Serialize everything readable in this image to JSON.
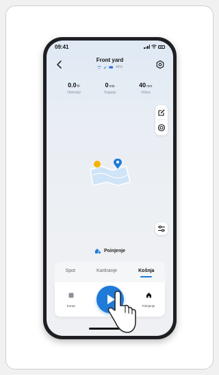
{
  "status_bar": {
    "time": "09:41"
  },
  "header": {
    "title": "Front yard",
    "battery_percent": "46%"
  },
  "stats": [
    {
      "value": "0.0",
      "unit": "ft²",
      "label": "Območje"
    },
    {
      "value": "0",
      "unit": "min",
      "label": "Trajanje"
    },
    {
      "value": "40",
      "unit": "mm",
      "label": "Višina"
    }
  ],
  "zone": {
    "label": "Poinjenje"
  },
  "modes": [
    {
      "label": "Spot",
      "active": false
    },
    {
      "label": "Kartiranje",
      "active": false
    },
    {
      "label": "Košnja",
      "active": true
    }
  ],
  "controls": {
    "stop_label": "Konec",
    "dock_label": "Polnjenje"
  },
  "colors": {
    "accent": "#1f7ad8",
    "background": "#eef0f3",
    "frame": "#1e1f22"
  },
  "icons": {
    "back": "chevron-left-icon",
    "settings": "hexagon-settings-icon",
    "edit": "edit-icon",
    "target": "target-icon",
    "adjust": "sliders-icon",
    "play": "play-icon",
    "stop": "stop-icon",
    "home": "home-icon",
    "zone": "mower-icon"
  }
}
